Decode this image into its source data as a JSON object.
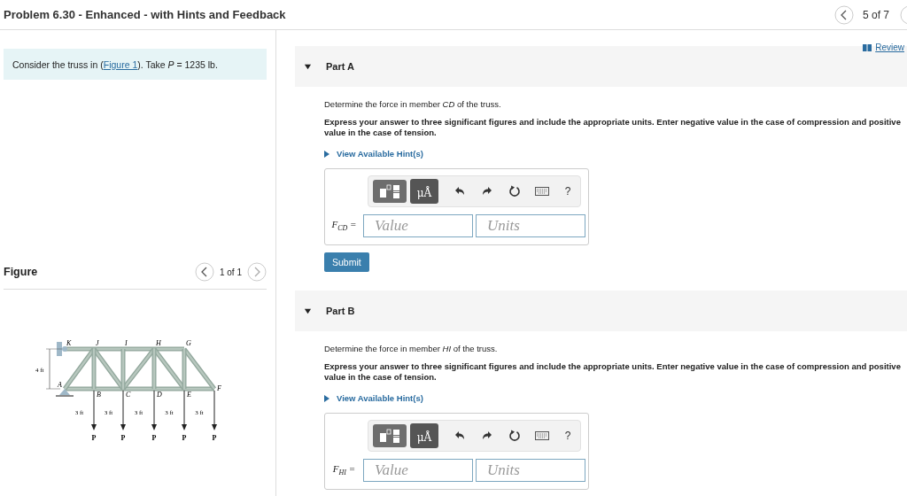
{
  "header": {
    "title": "Problem 6.30 - Enhanced - with Hints and Feedback",
    "position": "5 of 7"
  },
  "problem": {
    "before": "Consider the truss in (",
    "link": "Figure 1",
    "after": "). Take *P* = 1235 lb."
  },
  "figure": {
    "title": "Figure",
    "pager": "1 of 1",
    "top_labels": [
      "K",
      "J",
      "I",
      "H",
      "G"
    ],
    "bottom_labels": [
      "A",
      "B",
      "C",
      "D",
      "E",
      "F"
    ],
    "height_dim": "4 ft",
    "spacing_dims": [
      "3 ft",
      "3 ft",
      "3 ft",
      "3 ft",
      "3 ft"
    ],
    "loads": [
      "P",
      "P",
      "P",
      "P",
      "P"
    ]
  },
  "review": "Review",
  "parts": [
    {
      "title": "Part A",
      "expanded": true,
      "question": "Determine the force in member *CD* of the truss.",
      "instructions": "Express your answer to three significant figures and include the appropriate units. Enter negative value in the case of compression and positive value in the case of tension.",
      "hint": "View Available Hint(s)",
      "units_button": "μÅ",
      "help": "?",
      "answer_label": "F$_{CD}$ =",
      "value_placeholder": "Value",
      "units_placeholder": "Units",
      "submit": "Submit"
    },
    {
      "title": "Part B",
      "expanded": true,
      "question": "Determine the force in member *HI* of the truss.",
      "instructions": "Express your answer to three significant figures and include the appropriate units. Enter negative value in the case of compression and positive value in the case of tension.",
      "hint": "View Available Hint(s)",
      "units_button": "μÅ",
      "help": "?",
      "answer_label": "F$_{HI}$ =",
      "value_placeholder": "Value",
      "units_placeholder": "Units"
    }
  ]
}
